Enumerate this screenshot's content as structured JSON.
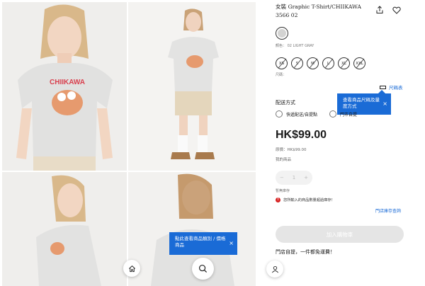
{
  "product": {
    "title": "女裝 Graphic T-Shirt/CHIIKAWA 3566 02",
    "color_label": "顏色： 02 LIGHT GRAY",
    "sizes": [
      "XS",
      "S",
      "M",
      "L",
      "XL",
      "XXL"
    ],
    "size_label": "尺碼：",
    "size_chart_link": "尺碼表",
    "size_tooltip": "查看商品尺碼及量度方式",
    "delivery_label": "配送方式",
    "delivery_options": [
      "快遞配送/自提點",
      "門市自提"
    ],
    "price": "HK$99.00",
    "original_price": "原價：HK$99.00",
    "points_label": "我的商品",
    "qty_minus": "−",
    "qty_value": "1",
    "qty_plus": "+",
    "stock_label": "暫無庫存",
    "stock_warning": "您所輸入的商品數量超過庫存！",
    "store_stock_link": "門店庫存查詢",
    "add_to_cart": "加入購物車",
    "pickup_note": "門店自提，一件都免運費！"
  },
  "gallery": {
    "photo_tooltip": "點此查看商品類別 / 價格商品",
    "print_text": "CHIIKAWA"
  },
  "icons": {
    "close": "×",
    "warn": "!"
  },
  "colors": {
    "accent": "#1a6bd6",
    "warning": "#d72323",
    "swatch": "#d3d3d2"
  }
}
